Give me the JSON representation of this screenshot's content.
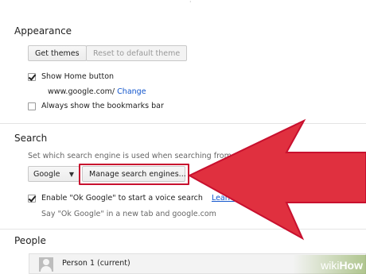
{
  "appearance": {
    "title": "Appearance",
    "get_themes": "Get themes",
    "reset_theme": "Reset to default theme",
    "show_home_label": "Show Home button",
    "home_url": "www.google.com/",
    "change_link": "Change",
    "bookmarks_label": "Always show the bookmarks bar"
  },
  "search": {
    "title": "Search",
    "description": "Set which search engine is used when searching from",
    "engine_selected": "Google",
    "manage_button": "Manage search engines...",
    "ok_google_label": "Enable \"Ok Google\" to start a voice search",
    "learn_more": "Learn mo",
    "ok_google_hint": "Say \"Ok Google\" in a new tab and google.com"
  },
  "people": {
    "title": "People",
    "person_name": "Person 1 (current)"
  },
  "watermark": {
    "wiki": "wiki",
    "how": "How"
  },
  "colors": {
    "arrow": "#e0303f",
    "arrow_stroke": "#c8102e",
    "link": "#1155cc"
  }
}
